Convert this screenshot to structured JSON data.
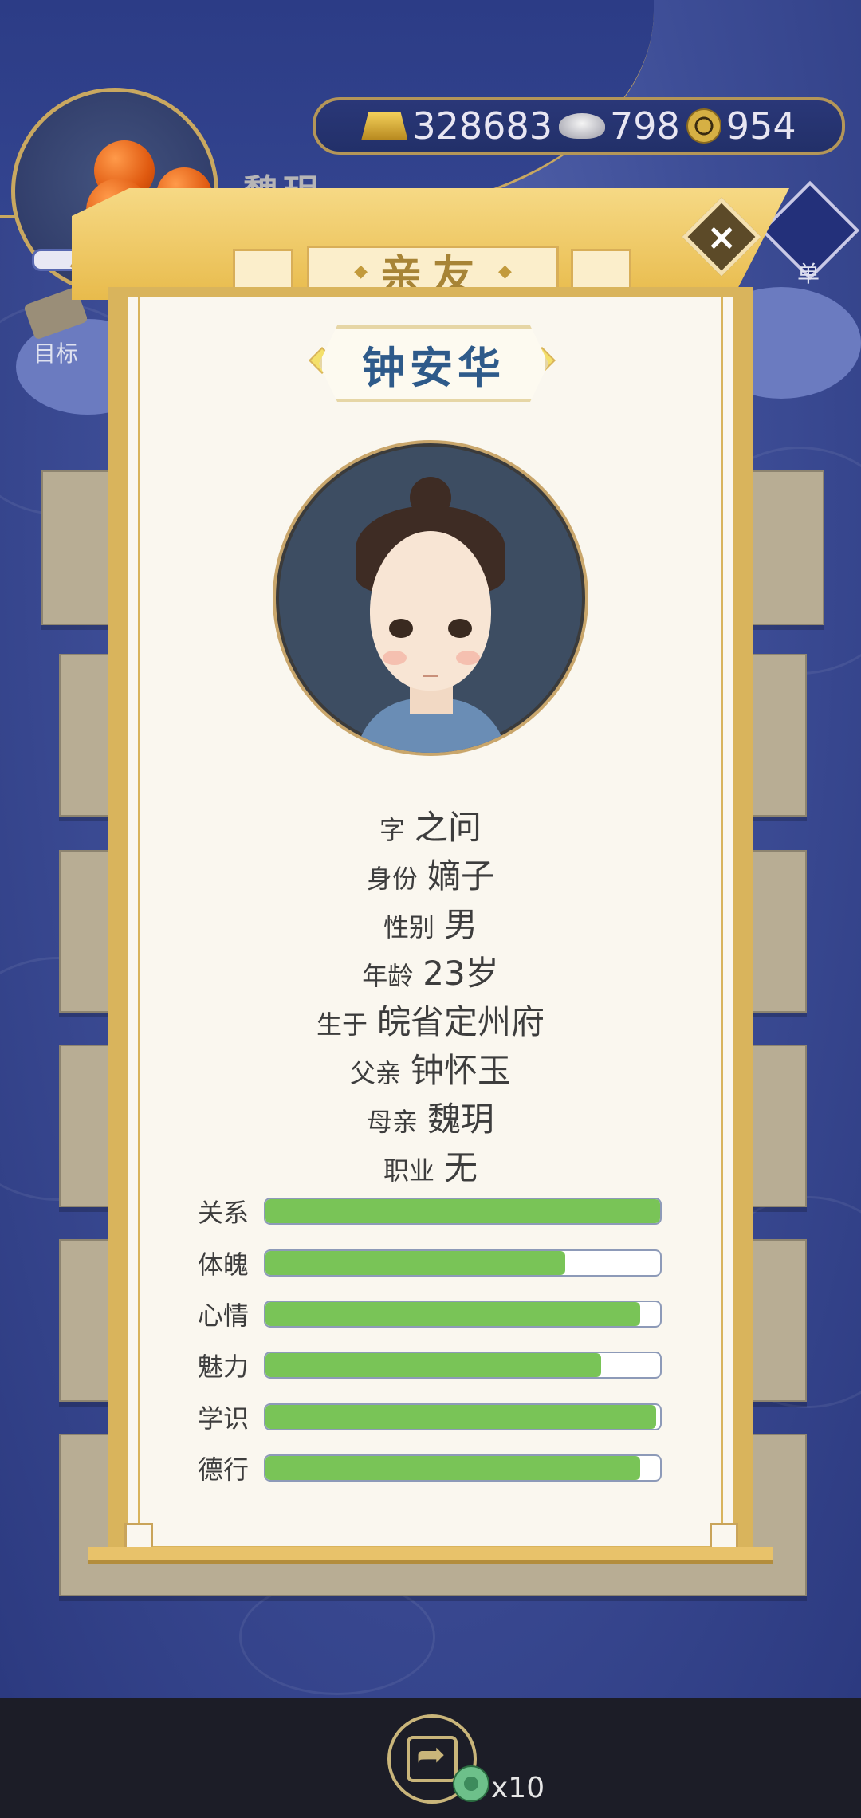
{
  "player": {
    "name": "魏玥"
  },
  "currency": {
    "gold": "328683",
    "silver": "798",
    "coins": "954"
  },
  "side": {
    "goal_label": "目标",
    "right_label": "单"
  },
  "modal": {
    "title": "亲友",
    "person": {
      "name": "钟安华",
      "fields": [
        {
          "key": "字",
          "value": "之问"
        },
        {
          "key": "身份",
          "value": "嫡子"
        },
        {
          "key": "性别",
          "value": "男"
        },
        {
          "key": "年龄",
          "value": "23岁"
        },
        {
          "key": "生于",
          "value": "皖省定州府"
        },
        {
          "key": "父亲",
          "value": "钟怀玉"
        },
        {
          "key": "母亲",
          "value": "魏玥"
        },
        {
          "key": "职业",
          "value": "无"
        }
      ],
      "stats": [
        {
          "label": "关系",
          "fraction": 1.0
        },
        {
          "label": "体魄",
          "fraction": 0.76
        },
        {
          "label": "心情",
          "fraction": 0.95
        },
        {
          "label": "魅力",
          "fraction": 0.85
        },
        {
          "label": "学识",
          "fraction": 0.99
        },
        {
          "label": "德行",
          "fraction": 0.95
        }
      ]
    }
  },
  "bottom": {
    "share_cost": "x10"
  },
  "colors": {
    "bar_fill": "#79c457",
    "name_color": "#2e5a8a",
    "accent_gold": "#d9b45c"
  }
}
